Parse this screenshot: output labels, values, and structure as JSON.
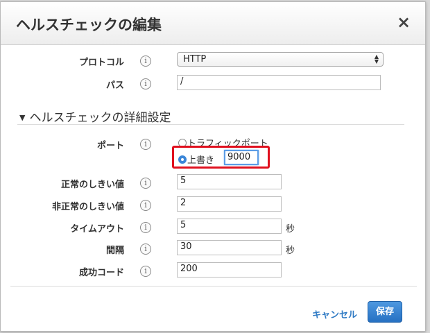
{
  "dialog": {
    "title": "ヘルスチェックの編集",
    "close_label": "×"
  },
  "fields": {
    "protocol": {
      "label": "プロトコル",
      "value": "HTTP"
    },
    "path": {
      "label": "パス",
      "value": "/"
    }
  },
  "advanced": {
    "toggle": "▼",
    "title": "ヘルスチェックの詳細設定",
    "port": {
      "label": "ポート",
      "option_traffic": "トラフィックポート",
      "option_override": "上書き",
      "override_value": "9000",
      "selected": "override"
    },
    "healthy_threshold": {
      "label": "正常のしきい値",
      "value": "5"
    },
    "unhealthy_threshold": {
      "label": "非正常のしきい値",
      "value": "2"
    },
    "timeout": {
      "label": "タイムアウト",
      "value": "5",
      "unit": "秒"
    },
    "interval": {
      "label": "間隔",
      "value": "30",
      "unit": "秒"
    },
    "success_codes": {
      "label": "成功コード",
      "value": "200"
    }
  },
  "info_icon_glyph": "i",
  "footer": {
    "cancel_label": "キャンセル",
    "save_label": "保存"
  },
  "colors": {
    "primary": "#2670c2",
    "link": "#2f7ac4",
    "highlight": "#e0101e"
  }
}
